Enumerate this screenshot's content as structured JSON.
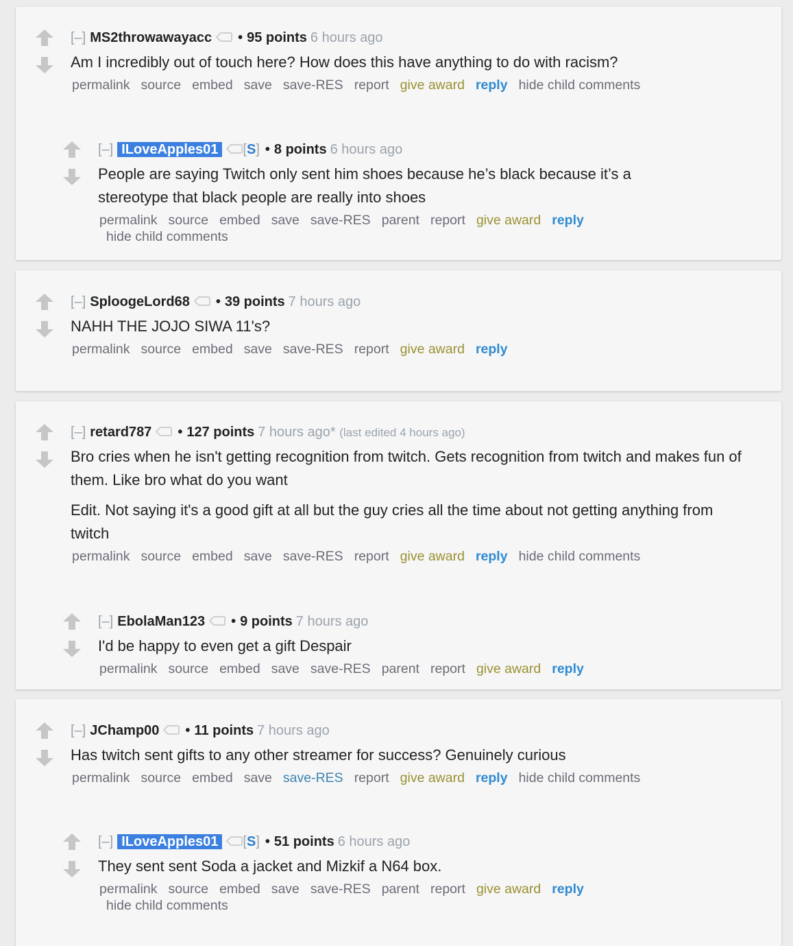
{
  "colors": {
    "page_bg": "#ececec",
    "card_bg": "#f6f6f6",
    "op_highlight": "#3b80e0",
    "give_award": "#9a9032",
    "reply": "#2e8ad2",
    "link_muted": "#6f6a78",
    "meta_gray": "#9aa3ad",
    "vote_arrow": "#c6c6c6"
  },
  "icons": {
    "upvote": "upvote-arrow-icon",
    "downvote": "downvote-arrow-icon",
    "user_tag": "user-tag-icon"
  },
  "collapse_label": "[–]",
  "bullet": "•",
  "threads": [
    {
      "comment": {
        "author": "MS2throwawayacc",
        "is_op": false,
        "score": "95 points",
        "time": "6 hours ago",
        "paragraphs": [
          "Am I incredibly out of touch here? How does this have anything to do with racism?"
        ],
        "buttons": [
          "permalink",
          "source",
          "embed",
          "save",
          "save-RES",
          "report",
          "give award",
          "reply",
          "hide child comments"
        ]
      },
      "reply": {
        "author": "ILoveApples01",
        "is_op": true,
        "submitter_flag": "S",
        "score": "8 points",
        "time": "6 hours ago",
        "paragraphs": [
          "People are saying Twitch only sent him shoes because he’s black because it’s a stereotype that black people are really into shoes"
        ],
        "buttons": [
          "permalink",
          "source",
          "embed",
          "save",
          "save-RES",
          "parent",
          "report",
          "give award",
          "reply",
          "hide child comments"
        ]
      }
    },
    {
      "comment": {
        "author": "SploogeLord68",
        "is_op": false,
        "score": "39 points",
        "time": "7 hours ago",
        "paragraphs": [
          "NAHH THE JOJO SIWA 11's?"
        ],
        "buttons": [
          "permalink",
          "source",
          "embed",
          "save",
          "save-RES",
          "report",
          "give award",
          "reply"
        ]
      }
    },
    {
      "comment": {
        "author": "retard787",
        "is_op": false,
        "score": "127 points",
        "time": "7 hours ago*",
        "edited": "(last edited 4 hours ago)",
        "paragraphs": [
          "Bro cries when he isn't getting recognition from twitch. Gets recognition from twitch and makes fun of them. Like bro what do you want",
          "Edit. Not saying it's a good gift at all but the guy cries all the time about not getting anything from twitch"
        ],
        "buttons": [
          "permalink",
          "source",
          "embed",
          "save",
          "save-RES",
          "report",
          "give award",
          "reply",
          "hide child comments"
        ]
      },
      "reply": {
        "author": "EbolaMan123",
        "is_op": false,
        "score": "9 points",
        "time": "7 hours ago",
        "paragraphs": [
          "I'd be happy to even get a gift Despair"
        ],
        "buttons": [
          "permalink",
          "source",
          "embed",
          "save",
          "save-RES",
          "parent",
          "report",
          "give award",
          "reply"
        ]
      }
    },
    {
      "comment": {
        "author": "JChamp00",
        "is_op": false,
        "score": "11 points",
        "time": "7 hours ago",
        "paragraphs": [
          "Has twitch sent gifts to any other streamer for success? Genuinely curious"
        ],
        "buttons": [
          "permalink",
          "source",
          "embed",
          "save",
          "save-RES",
          "report",
          "give award",
          "reply",
          "hide child comments"
        ]
      },
      "reply": {
        "author": "ILoveApples01",
        "is_op": true,
        "submitter_flag": "S",
        "score": "51 points",
        "time": "6 hours ago",
        "paragraphs": [
          "They sent sent Soda a jacket and Mizkif a N64 box."
        ],
        "buttons": [
          "permalink",
          "source",
          "embed",
          "save",
          "save-RES",
          "parent",
          "report",
          "give award",
          "reply",
          "hide child comments"
        ]
      }
    }
  ]
}
